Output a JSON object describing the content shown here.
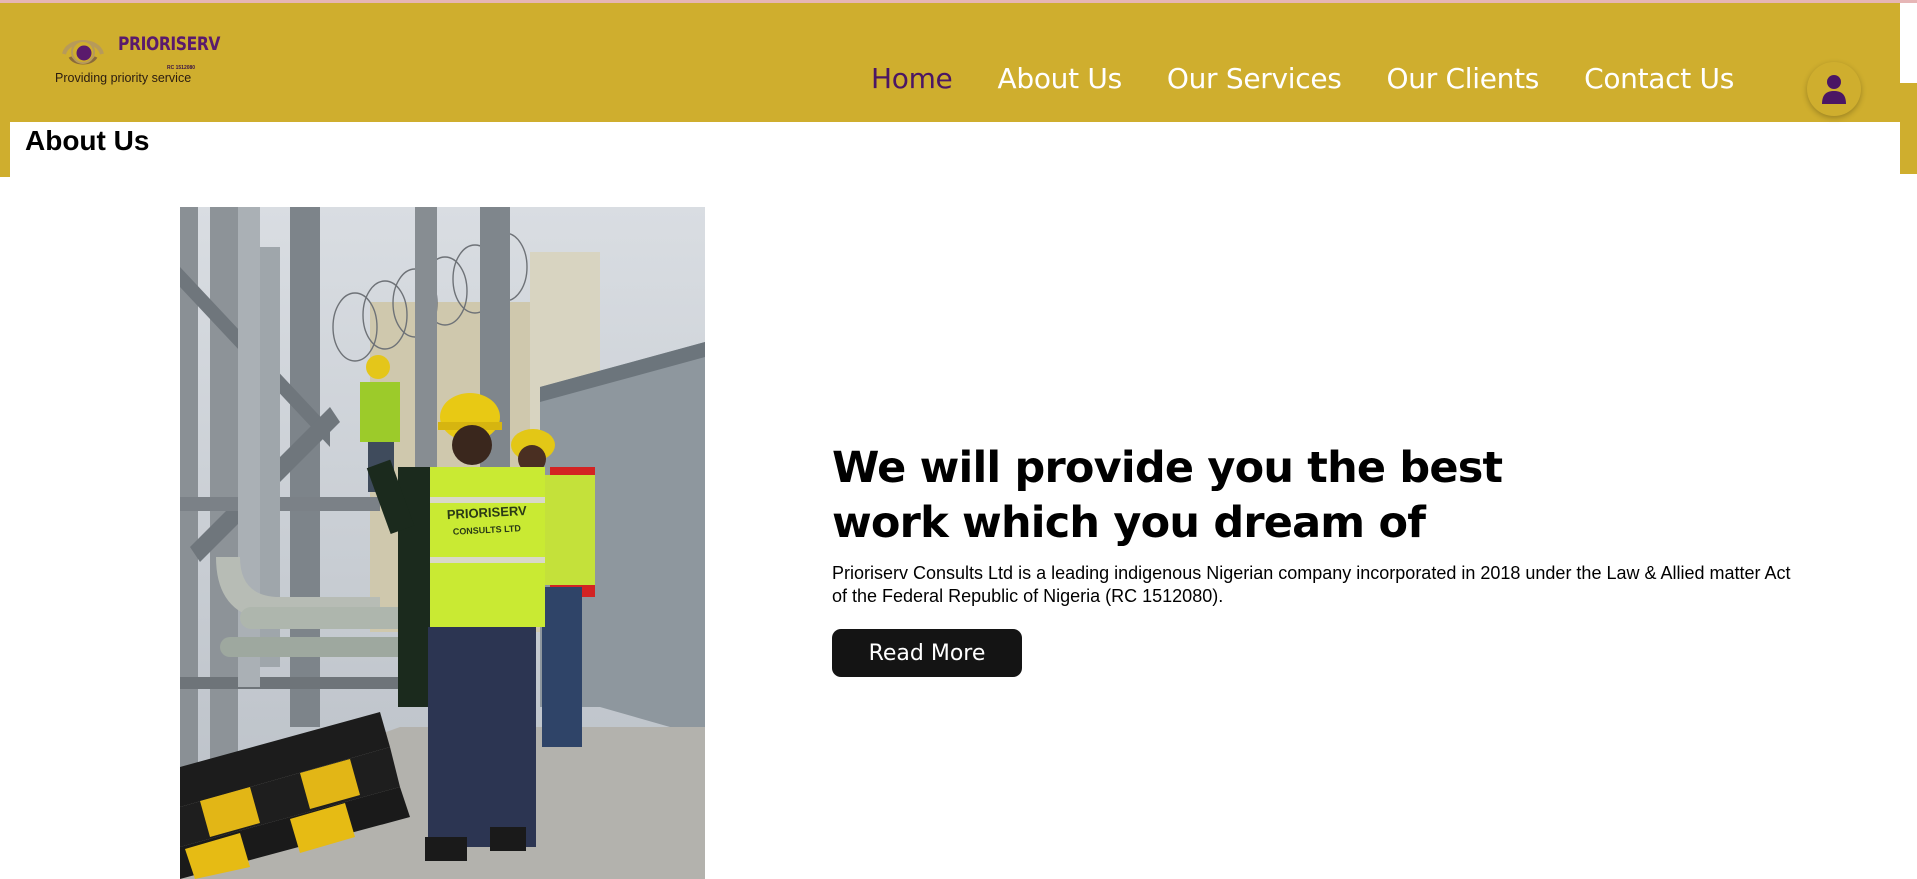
{
  "brand": {
    "name": "PRIORISERV",
    "rc": "RC 1512080",
    "tagline": "Providing priority service"
  },
  "nav": {
    "items": [
      {
        "label": "Home",
        "active": true
      },
      {
        "label": "About Us",
        "active": false
      },
      {
        "label": "Our Services",
        "active": false
      },
      {
        "label": "Our Clients",
        "active": false
      },
      {
        "label": "Contact Us",
        "active": false
      }
    ],
    "user_icon": "user-icon"
  },
  "page": {
    "title": "About Us"
  },
  "hero": {
    "headline": "We will provide you the best work which you dream of",
    "description": "Prioriserv Consults Ltd is a leading indigenous Nigerian company incorporated in 2018 under the Law & Allied matter Act of the Federal Republic of Nigeria (RC 1512080).",
    "button_label": "Read More",
    "photo_vest_text": "PRIORISERV CONSULTS LTD"
  },
  "colors": {
    "header": "#cfae2e",
    "accent_purple": "#4b1664",
    "button": "#141414"
  }
}
